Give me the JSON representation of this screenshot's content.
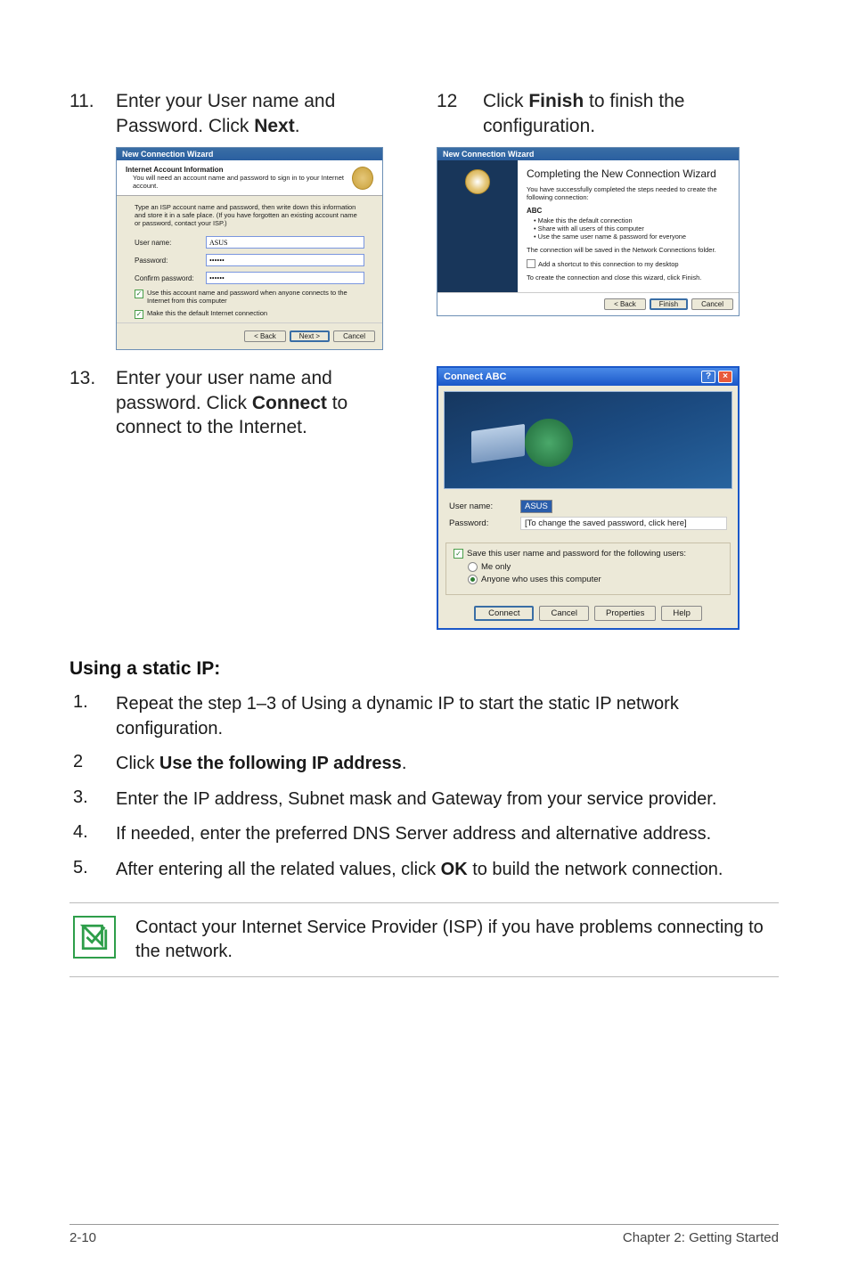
{
  "step11": {
    "num": "11.",
    "text_before": "Enter your User name and Password. Click ",
    "bold": "Next",
    "text_after": "."
  },
  "step12": {
    "num": "12",
    "text_before": "Click ",
    "bold": "Finish",
    "text_after": " to finish the configuration."
  },
  "step13": {
    "num": "13.",
    "text_before": "Enter your user name and password. Click ",
    "bold": "Connect",
    "text_after": " to connect to the Internet."
  },
  "wizard1": {
    "title": "New Connection Wizard",
    "header_bold": "Internet Account Information",
    "header_sub": "You will need an account name and password to sign in to your Internet account.",
    "hint": "Type an ISP account name and password, then write down this information and store it in a safe place. (If you have forgotten an existing account name or password, contact your ISP.)",
    "user_label": "User name:",
    "user_value": "ASUS",
    "pass_label": "Password:",
    "pass_value": "••••••",
    "confirm_label": "Confirm password:",
    "confirm_value": "••••••",
    "chk1": "Use this account name and password when anyone connects to the Internet from this computer",
    "chk2": "Make this the default Internet connection",
    "btn_back": "< Back",
    "btn_next": "Next >",
    "btn_cancel": "Cancel"
  },
  "wizard2": {
    "title": "New Connection Wizard",
    "heading": "Completing the New Connection Wizard",
    "p1": "You have successfully completed the steps needed to create the following connection:",
    "conn_name": "ABC",
    "bullets": [
      "Make this the default connection",
      "Share with all users of this computer",
      "Use the same user name & password for everyone"
    ],
    "p2": "The connection will be saved in the Network Connections folder.",
    "shortcut": "Add a shortcut to this connection to my desktop",
    "p3": "To create the connection and close this wizard, click Finish.",
    "btn_back": "< Back",
    "btn_finish": "Finish",
    "btn_cancel": "Cancel"
  },
  "connect": {
    "title": "Connect ABC",
    "user_label": "User name:",
    "user_value": "ASUS",
    "pass_label": "Password:",
    "pass_value": "[To change the saved password, click here]",
    "save_label": "Save this user name and password for the following users:",
    "radio_me": "Me only",
    "radio_anyone": "Anyone who uses this computer",
    "btn_connect": "Connect",
    "btn_cancel": "Cancel",
    "btn_properties": "Properties",
    "btn_help": "Help"
  },
  "static_ip": {
    "heading": "Using a static IP:",
    "items": [
      {
        "n": "1.",
        "t": "Repeat the step 1–3 of Using a dynamic IP to start the static IP network configuration."
      },
      {
        "n": "2",
        "t_before": "Click ",
        "b": "Use the following IP address",
        "t_after": "."
      },
      {
        "n": "3.",
        "t": "Enter the IP address, Subnet mask and Gateway from your service provider."
      },
      {
        "n": "4.",
        "t": "If needed, enter the preferred DNS Server address and alternative address."
      },
      {
        "n": "5.",
        "t_before": "After entering all the related values, click ",
        "b": "OK",
        "t_after": " to build the network connection."
      }
    ]
  },
  "note": "Contact your Internet Service Provider (ISP) if you have problems connecting to the network.",
  "footer": {
    "page": "2-10",
    "chapter": "Chapter 2: Getting Started"
  }
}
